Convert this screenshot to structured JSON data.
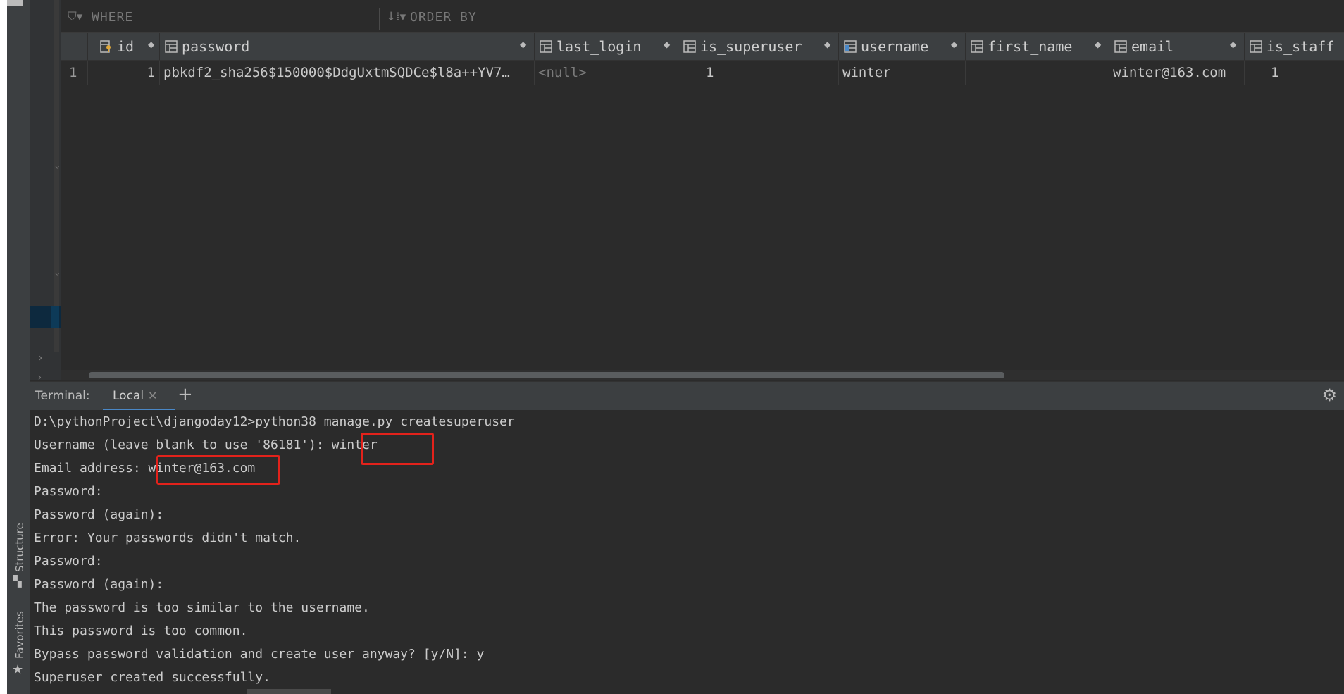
{
  "side_panel": {
    "tabs": [
      {
        "label": "Structure",
        "icon": "structure-icon"
      },
      {
        "label": "Favorites",
        "icon": "star-icon"
      }
    ]
  },
  "filter_bar": {
    "where_label": "WHERE",
    "order_by_label": "ORDER BY"
  },
  "table": {
    "columns": [
      {
        "name": "id",
        "icon": "primary-key-column-icon",
        "icon_color": "#e0a83a"
      },
      {
        "name": "password",
        "icon": "column-icon"
      },
      {
        "name": "last_login",
        "icon": "column-icon"
      },
      {
        "name": "is_superuser",
        "icon": "column-icon"
      },
      {
        "name": "username",
        "icon": "indexed-column-icon",
        "icon_color": "#4a88c7"
      },
      {
        "name": "first_name",
        "icon": "column-icon"
      },
      {
        "name": "email",
        "icon": "column-icon"
      },
      {
        "name": "is_staff",
        "icon": "column-icon"
      }
    ],
    "rows": [
      {
        "row_number": "1",
        "id": "1",
        "password": "pbkdf2_sha256$150000$DdgUxtmSQDCe$l8a++YV7…",
        "last_login": "<null>",
        "is_superuser": "1",
        "username": "winter",
        "first_name": "",
        "email": "winter@163.com",
        "is_staff": "1"
      }
    ]
  },
  "terminal": {
    "title": "Terminal:",
    "tab_label": "Local",
    "lines": [
      "D:\\pythonProject\\djangoday12>python38 manage.py createsuperuser",
      "Username (leave blank to use '86181'): winter",
      "Email address: winter@163.com",
      "Password:",
      "Password (again):",
      "Error: Your passwords didn't match.",
      "Password:",
      "Password (again):",
      "The password is too similar to the username.",
      "This password is too common.",
      "Bypass password validation and create user anyway? [y/N]: y",
      "Superuser created successfully."
    ],
    "highlight_color": "#e3221b"
  },
  "colors": {
    "background": "#2b2b2b",
    "panel": "#3c3f41",
    "text": "#bbbbbb",
    "accent": "#4a88c7",
    "highlight": "#e3221b"
  }
}
